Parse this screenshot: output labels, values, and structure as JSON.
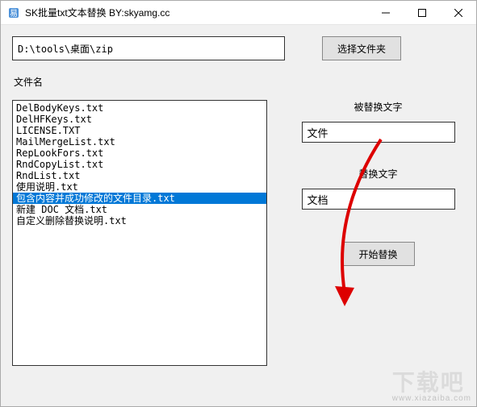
{
  "window": {
    "title": "SK批量txt文本替换 BY:skyamg.cc"
  },
  "path": {
    "value": "D:\\tools\\桌面\\zip"
  },
  "buttons": {
    "selectFolder": "选择文件夹",
    "startReplace": "开始替换"
  },
  "labels": {
    "filename": "文件名",
    "searchText": "被替换文字",
    "replaceText": "替换文字"
  },
  "files": [
    {
      "name": "DelBodyKeys.txt",
      "selected": false
    },
    {
      "name": "DelHFKeys.txt",
      "selected": false
    },
    {
      "name": "LICENSE.TXT",
      "selected": false
    },
    {
      "name": "MailMergeList.txt",
      "selected": false
    },
    {
      "name": "RepLookFors.txt",
      "selected": false
    },
    {
      "name": "RndCopyList.txt",
      "selected": false
    },
    {
      "name": "RndList.txt",
      "selected": false
    },
    {
      "name": "使用说明.txt",
      "selected": false
    },
    {
      "name": "包含内容并成功修改的文件目录.txt",
      "selected": true
    },
    {
      "name": "新建 DOC 文档.txt",
      "selected": false
    },
    {
      "name": "自定义删除替换说明.txt",
      "selected": false
    }
  ],
  "inputs": {
    "searchValue": "文件",
    "replaceValue": "文档"
  },
  "watermark": {
    "big": "下载吧",
    "small": "www.xiazaiba.com"
  }
}
